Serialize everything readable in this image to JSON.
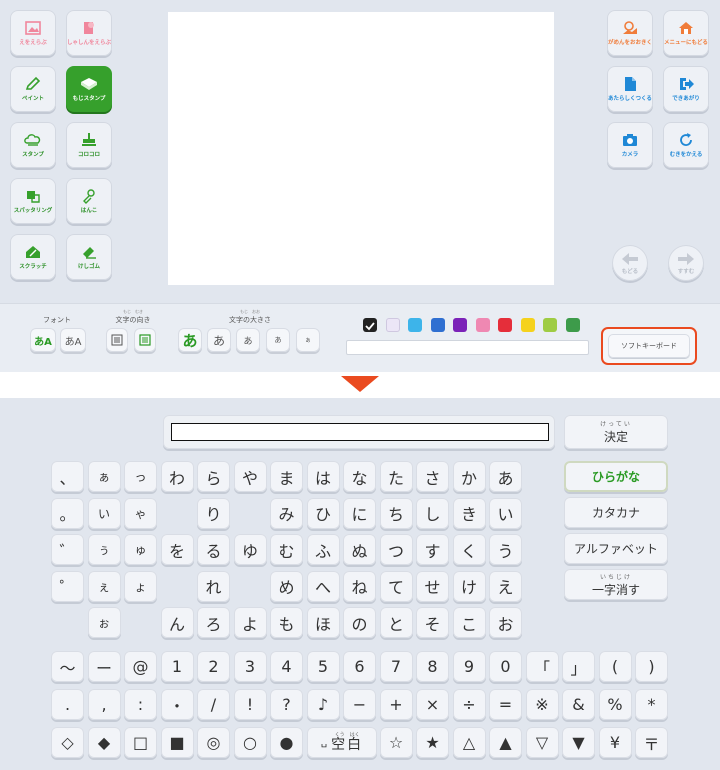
{
  "editor": {
    "left_tools": [
      {
        "name": "upload-image-button",
        "label": "えをえらぶ",
        "icon": "picture-icon",
        "color": "pink"
      },
      {
        "name": "upload-photo-button",
        "label": "しゃしんをえらぶ",
        "icon": "photo-icon",
        "color": "pink"
      },
      {
        "name": "paint-button",
        "label": "ペイント",
        "icon": "pencil-icon",
        "color": "green"
      },
      {
        "name": "text-stamp-button",
        "label": "もじスタンプ",
        "icon": "keyboard-icon",
        "color": "green",
        "active": true
      },
      {
        "name": "stamp-button",
        "label": "スタンプ",
        "icon": "cloud-stamp-icon",
        "color": "green"
      },
      {
        "name": "roller-button",
        "label": "コロコロ",
        "icon": "roller-icon",
        "color": "green"
      },
      {
        "name": "splatter-button",
        "label": "スパッタリング",
        "icon": "splatter-icon",
        "color": "green"
      },
      {
        "name": "hanko-button",
        "label": "はんこ",
        "icon": "hanko-icon",
        "color": "green"
      },
      {
        "name": "scratch-button",
        "label": "スクラッチ",
        "icon": "scratch-icon",
        "color": "green"
      },
      {
        "name": "eraser-button",
        "label": "けしゴム",
        "icon": "eraser-icon",
        "color": "green"
      }
    ],
    "right_tools": [
      {
        "name": "save-image-button",
        "label": "がめんをおおきく",
        "icon": "magnify-image-icon",
        "color": "orange"
      },
      {
        "name": "menu-button",
        "label": "メニューにもどる",
        "icon": "home-icon",
        "color": "orange"
      },
      {
        "name": "new-button",
        "label": "あたらしくつくる",
        "icon": "new-file-icon",
        "color": "blue"
      },
      {
        "name": "done-button",
        "label": "できあがり",
        "icon": "exit-icon",
        "color": "blue"
      },
      {
        "name": "camera-button",
        "label": "カメラ",
        "icon": "camera-icon",
        "color": "blue"
      },
      {
        "name": "restart-button",
        "label": "むきをかえる",
        "icon": "rotate-icon",
        "color": "blue"
      }
    ],
    "undo_label": "もどる",
    "redo_label": "すすむ"
  },
  "toolbar": {
    "font_label": "フォント",
    "font_options": [
      "あA",
      "あA"
    ],
    "direction_label": "文字の向き",
    "direction_ruby": "もじ　むき",
    "size_label": "文字の大きさ",
    "size_ruby": "もじ　おお",
    "size_options": [
      "あ",
      "あ",
      "あ",
      "あ",
      "あ"
    ],
    "colors": [
      "#222222",
      "#ece6f7",
      "#3db4ea",
      "#2f6fd1",
      "#7b22b8",
      "#ef88b2",
      "#e52e3a",
      "#f5d21c",
      "#9fcc43",
      "#3d9b4a"
    ],
    "soft_keyboard_label": "ソフトキーボード"
  },
  "keyboard": {
    "confirm_ruby": "けってい",
    "confirm_label": "決定",
    "modes": [
      "ひらがな",
      "カタカナ",
      "アルファベット"
    ],
    "delete_ruby": "いちじけ",
    "delete_label": "一字消す",
    "kana_rows": [
      [
        "、",
        "ぁ",
        "っ",
        "わ",
        "ら",
        "や",
        "ま",
        "は",
        "な",
        "た",
        "さ",
        "か",
        "あ"
      ],
      [
        "。",
        "い",
        "ゃ",
        "",
        "り",
        "",
        "み",
        "ひ",
        "に",
        "ち",
        "し",
        "き",
        "い"
      ],
      [
        "゛",
        "ぅ",
        "ゅ",
        "を",
        "る",
        "ゆ",
        "む",
        "ふ",
        "ぬ",
        "つ",
        "す",
        "く",
        "う"
      ],
      [
        "゜",
        "ぇ",
        "ょ",
        "",
        "れ",
        "",
        "め",
        "へ",
        "ね",
        "て",
        "せ",
        "け",
        "え"
      ],
      [
        "",
        "ぉ",
        "",
        "ん",
        "ろ",
        "よ",
        "も",
        "ほ",
        "の",
        "と",
        "そ",
        "こ",
        "お"
      ]
    ],
    "symbol_rows": [
      [
        "〜",
        "ー",
        "@",
        "1",
        "2",
        "3",
        "4",
        "5",
        "6",
        "7",
        "8",
        "9",
        "0",
        "「",
        "」",
        "(",
        ")"
      ],
      [
        ".",
        ",",
        ":",
        "・",
        "/",
        "!",
        "?",
        "♪",
        "−",
        "+",
        "×",
        "÷",
        "=",
        "※",
        "&",
        "%",
        "*"
      ],
      [
        "◇",
        "◆",
        "□",
        "■",
        "◎",
        "○",
        "●",
        "",
        "",
        "☆",
        "★",
        "△",
        "▲",
        "▽",
        "▼",
        "¥",
        "〒"
      ]
    ],
    "space_ruby": "くう　はく",
    "space_label": "空白",
    "space_symbol": "␣"
  }
}
